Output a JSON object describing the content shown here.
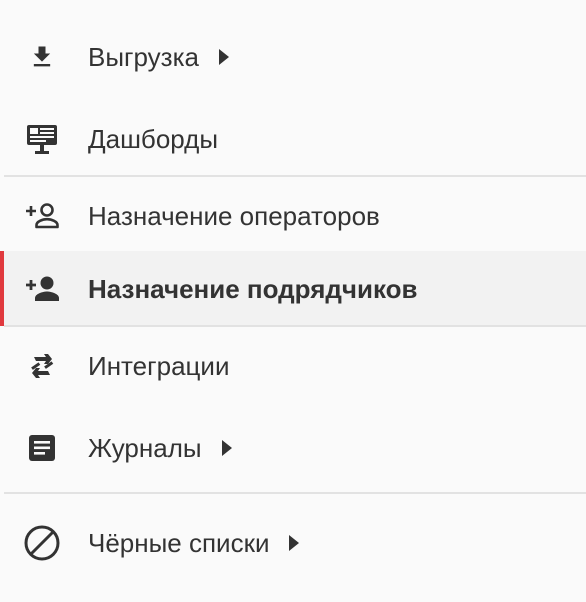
{
  "menu": {
    "items": [
      {
        "label": "Выгрузка",
        "icon": "download-icon",
        "has_submenu": true
      },
      {
        "label": "Дашборды",
        "icon": "dashboard-icon",
        "has_submenu": false
      },
      {
        "label": "Назначение операторов",
        "icon": "person-add-outline-icon",
        "has_submenu": false
      },
      {
        "label": "Назначение подрядчиков",
        "icon": "person-add-filled-icon",
        "has_submenu": false,
        "active": true
      },
      {
        "label": "Интеграции",
        "icon": "integration-icon",
        "has_submenu": false
      },
      {
        "label": "Журналы",
        "icon": "journal-icon",
        "has_submenu": true
      },
      {
        "label": "Чёрные списки",
        "icon": "block-icon",
        "has_submenu": true
      }
    ]
  },
  "colors": {
    "background": "#fafafa",
    "active_background": "#f2f2f2",
    "active_indicator": "#e0393e",
    "text": "#333333",
    "divider": "#e2e2e2"
  }
}
